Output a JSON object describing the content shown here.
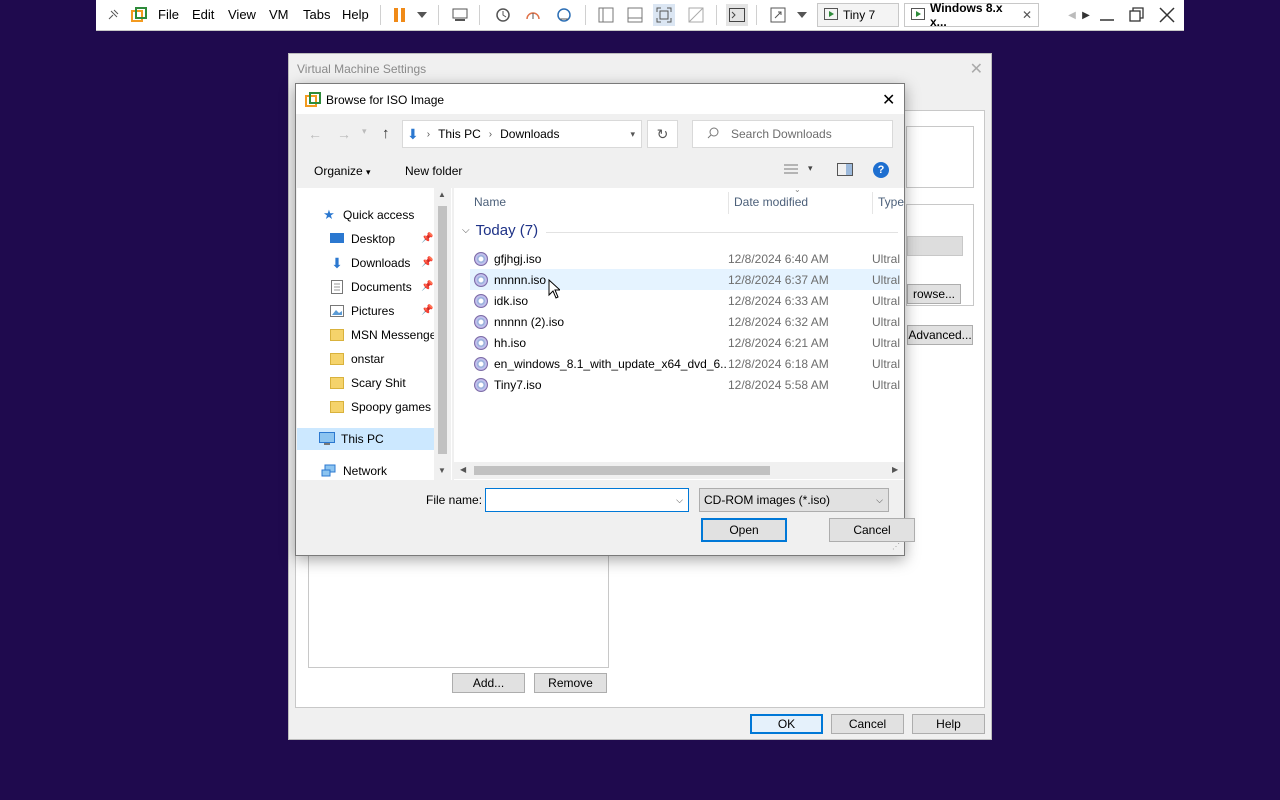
{
  "vm_toolbar": {
    "menus": [
      "File",
      "Edit",
      "View",
      "VM",
      "Tabs",
      "Help"
    ],
    "tabs": [
      {
        "label": "Tiny 7"
      },
      {
        "label": "Windows 8.x x..."
      }
    ]
  },
  "vm_settings": {
    "title": "Virtual Machine Settings",
    "partial_browse_label": "rowse...",
    "advanced_label": "Advanced...",
    "add_label": "Add...",
    "remove_label": "Remove",
    "ok_label": "OK",
    "cancel_label": "Cancel",
    "help_label": "Help"
  },
  "browse_dialog": {
    "title": "Browse for ISO Image",
    "breadcrumb": [
      "This PC",
      "Downloads"
    ],
    "search_placeholder": "Search Downloads",
    "organize_label": "Organize",
    "new_folder_label": "New folder",
    "nav_tree": [
      {
        "label": "Quick access",
        "icon": "star-icon",
        "pinned": false
      },
      {
        "label": "Desktop",
        "icon": "desktop-icon",
        "pinned": true
      },
      {
        "label": "Downloads",
        "icon": "download-icon",
        "pinned": true
      },
      {
        "label": "Documents",
        "icon": "document-icon",
        "pinned": true
      },
      {
        "label": "Pictures",
        "icon": "picture-icon",
        "pinned": true
      },
      {
        "label": "MSN Messenger",
        "icon": "folder-icon",
        "pinned": false
      },
      {
        "label": "onstar",
        "icon": "folder-icon",
        "pinned": false
      },
      {
        "label": "Scary Shit",
        "icon": "folder-icon",
        "pinned": false
      },
      {
        "label": "Spoopy games",
        "icon": "folder-icon",
        "pinned": false
      },
      {
        "label": "This PC",
        "icon": "computer-icon",
        "pinned": false
      },
      {
        "label": "Network",
        "icon": "network-icon",
        "pinned": false
      }
    ],
    "columns": [
      "Name",
      "Date modified",
      "Type"
    ],
    "group_label": "Today (7)",
    "files": [
      {
        "name": "gfjhgj.iso",
        "date": "12/8/2024 6:40 AM",
        "type": "Ultral"
      },
      {
        "name": "nnnnn.iso",
        "date": "12/8/2024 6:37 AM",
        "type": "Ultral"
      },
      {
        "name": "idk.iso",
        "date": "12/8/2024 6:33 AM",
        "type": "Ultral"
      },
      {
        "name": "nnnnn (2).iso",
        "date": "12/8/2024 6:32 AM",
        "type": "Ultral"
      },
      {
        "name": "hh.iso",
        "date": "12/8/2024 6:21 AM",
        "type": "Ultral"
      },
      {
        "name": "en_windows_8.1_with_update_x64_dvd_6...",
        "date": "12/8/2024 6:18 AM",
        "type": "Ultral"
      },
      {
        "name": "Tiny7.iso",
        "date": "12/8/2024 5:58 AM",
        "type": "Ultral"
      }
    ],
    "file_name_label": "File name:",
    "file_name_value": "",
    "file_type_value": "CD-ROM images (*.iso)",
    "open_label": "Open",
    "cancel_label": "Cancel"
  },
  "colors": {
    "desktop": "#1f0a4e",
    "accent": "#0078d7",
    "hover_row": "#e5f3ff",
    "selected_tree": "#cce8ff"
  }
}
